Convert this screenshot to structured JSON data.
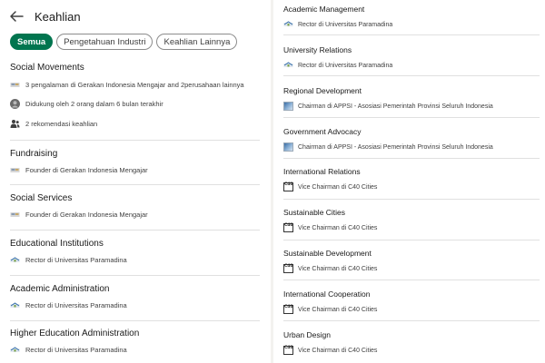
{
  "header": {
    "title": "Keahlian"
  },
  "filters": [
    {
      "label": "Semua",
      "active": true
    },
    {
      "label": "Pengetahuan Industri",
      "active": false
    },
    {
      "label": "Keahlian Lainnya",
      "active": false
    }
  ],
  "left_skills": [
    {
      "name": "Social Movements",
      "details": [
        {
          "icon": "company-logo-icon",
          "text": "3 pengalaman di Gerakan Indonesia Mengajar and 2perusahaan lainnya"
        },
        {
          "icon": "avatar-icon",
          "text": "Didukung oleh 2 orang dalam 6 bulan terakhir"
        },
        {
          "icon": "people-icon",
          "text": "2 rekomendasi keahlian"
        }
      ]
    },
    {
      "name": "Fundraising",
      "details": [
        {
          "icon": "company-logo-icon",
          "text": "Founder di Gerakan Indonesia Mengajar"
        }
      ]
    },
    {
      "name": "Social Services",
      "details": [
        {
          "icon": "company-logo-icon",
          "text": "Founder di Gerakan Indonesia Mengajar"
        }
      ]
    },
    {
      "name": "Educational Institutions",
      "details": [
        {
          "icon": "university-logo-icon",
          "text": "Rector di Universitas Paramadina"
        }
      ]
    },
    {
      "name": "Academic Administration",
      "details": [
        {
          "icon": "university-logo-icon",
          "text": "Rector di Universitas Paramadina"
        }
      ]
    },
    {
      "name": "Higher Education Administration",
      "details": [
        {
          "icon": "university-logo-icon",
          "text": "Rector di Universitas Paramadina"
        }
      ]
    }
  ],
  "right_skills": [
    {
      "name": "Academic Management",
      "detail": "Rector di Universitas Paramadina",
      "icon": "university-logo-icon"
    },
    {
      "name": "University Relations",
      "detail": "Rector di Universitas Paramadina",
      "icon": "university-logo-icon"
    },
    {
      "name": "Regional Development",
      "detail": "Chairman di APPSI - Asosiasi Pemerintah Provinsi Seluruh Indonesia",
      "icon": "appsi-logo-icon"
    },
    {
      "name": "Government Advocacy",
      "detail": "Chairman di APPSI - Asosiasi Pemerintah Provinsi Seluruh Indonesia",
      "icon": "appsi-logo-icon"
    },
    {
      "name": "International Relations",
      "detail": "Vice Chairman di C40 Cities",
      "icon": "c40-logo-icon"
    },
    {
      "name": "Sustainable Cities",
      "detail": "Vice Chairman di C40 Cities",
      "icon": "c40-logo-icon"
    },
    {
      "name": "Sustainable Development",
      "detail": "Vice Chairman di C40 Cities",
      "icon": "c40-logo-icon"
    },
    {
      "name": "International Cooperation",
      "detail": "Vice Chairman di C40 Cities",
      "icon": "c40-logo-icon"
    },
    {
      "name": "Urban Design",
      "detail": "Vice Chairman di C40 Cities",
      "icon": "c40-logo-icon"
    }
  ],
  "logo_text": {
    "c40": "C40"
  },
  "colors": {
    "accent": "#01754f",
    "divider": "#e0e0e0",
    "text": "#191919",
    "muted": "#404040"
  }
}
